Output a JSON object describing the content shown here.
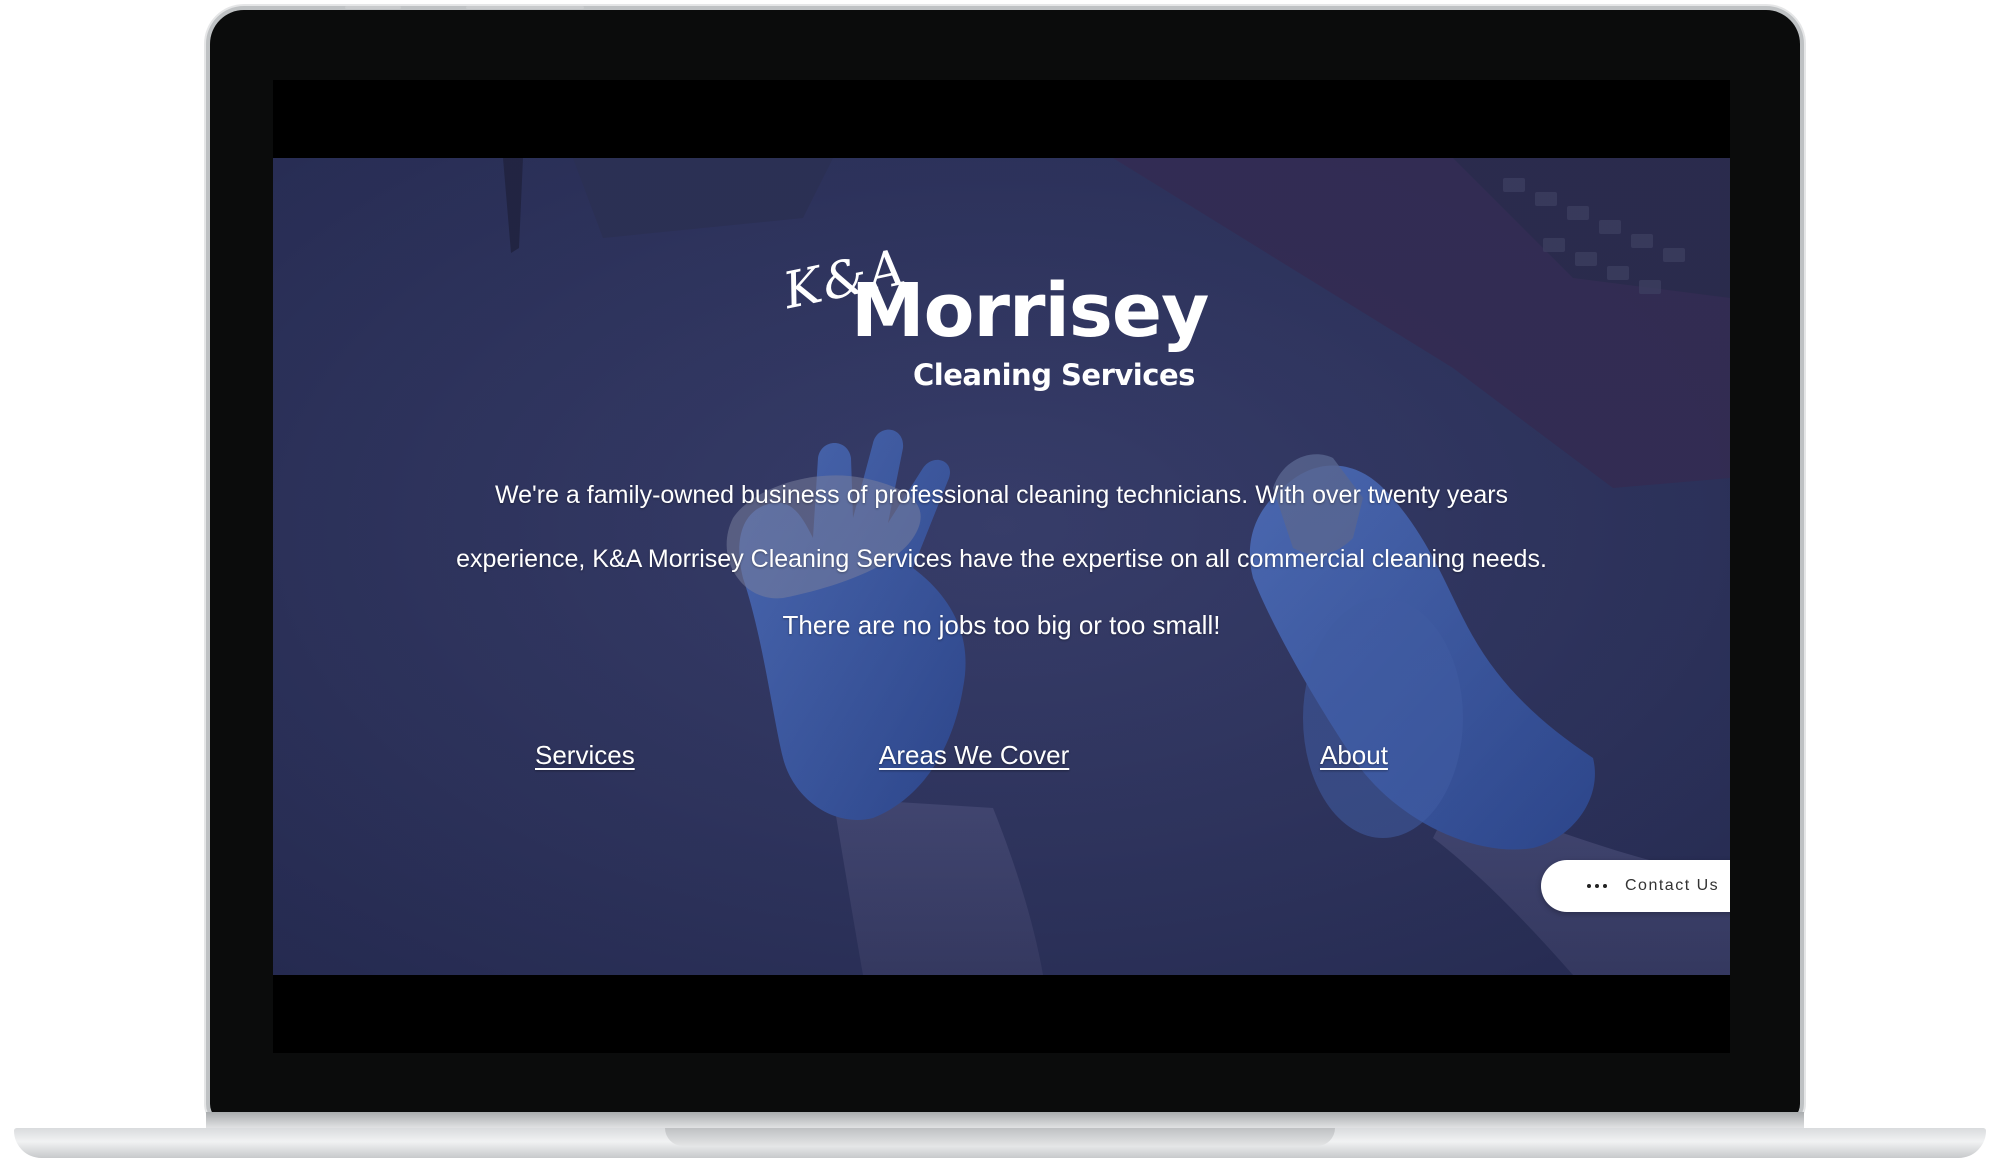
{
  "logo": {
    "script": "K&A",
    "name": "Morrisey",
    "subtitle": "Cleaning Services"
  },
  "intro": {
    "line1": "We're a family-owned business of professional cleaning technicians. With over twenty years",
    "line2": "experience, K&A Morrisey Cleaning Services have the expertise on all commercial cleaning needs."
  },
  "tagline": "There are no jobs too big or too small!",
  "nav": {
    "services": "Services",
    "areas": "Areas We Cover",
    "about": "About"
  },
  "contact": {
    "label": "Contact Us",
    "icon": "more-dots-icon"
  },
  "colors": {
    "overlay": "#2e3358",
    "glove": "#3f64b8",
    "text": "#ffffff"
  }
}
